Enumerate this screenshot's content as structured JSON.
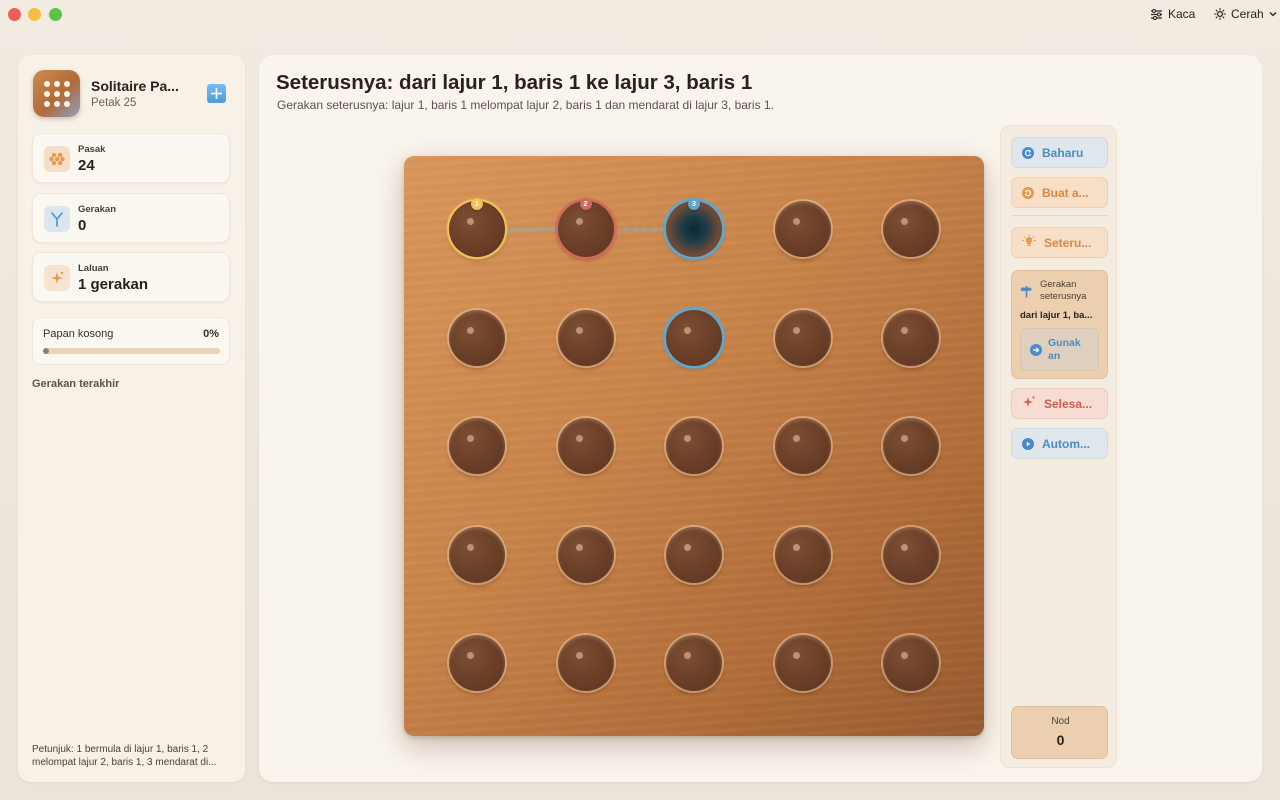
{
  "titlebar": {
    "glass_label": "Kaca",
    "theme_label": "Cerah",
    "glass_icon": "sliders-icon",
    "theme_icon": "sun-icon"
  },
  "sidebar": {
    "app_name": "Solitaire Pa...",
    "app_subtitle": "Petak 25",
    "stats": [
      {
        "label": "Pasak",
        "value": "24",
        "icon": "pegs-icon",
        "color": "#e39a4c"
      },
      {
        "label": "Gerakan",
        "value": "0",
        "icon": "branch-icon",
        "color": "#4b9be0"
      },
      {
        "label": "Laluan",
        "value": "1 gerakan",
        "icon": "sparkle-icon",
        "color": "#e39a4c"
      }
    ],
    "progress": {
      "label": "Papan kosong",
      "percent_text": "0%",
      "fraction": 0.0
    },
    "recent_title": "Gerakan terakhir",
    "hint": "Petunjuk: 1 bermula di lajur 1, baris 1, 2 melompat lajur 2, baris 1, 3 mendarat di..."
  },
  "main": {
    "title": "Seterusnya: dari lajur 1, baris 1 ke lajur 3, baris 1",
    "subtitle": "Gerakan seterusnya: lajur 1, baris 1 melompat lajur 2, baris 1 dan mendarat di lajur 3, baris 1."
  },
  "board": {
    "rows": 5,
    "cols": 5,
    "empty": [
      [
        0,
        2
      ]
    ],
    "highlight": [
      {
        "row": 0,
        "col": 0,
        "style": "gold",
        "badge": "1",
        "color": "#f1c25b"
      },
      {
        "row": 0,
        "col": 1,
        "style": "red",
        "badge": "2",
        "color": "#d06a5d"
      },
      {
        "row": 0,
        "col": 2,
        "style": "blue",
        "badge": "3",
        "color": "#5fa7cf"
      },
      {
        "row": 1,
        "col": 2,
        "style": "blue"
      }
    ]
  },
  "toolbar": {
    "new_label": "Baharu",
    "create_label": "Buat a...",
    "next_label": "Seteru...",
    "next_card": {
      "title": "Gerakan seterusnya",
      "move": "dari lajur 1, ba...",
      "use_label": "Gunak an"
    },
    "solve_label": "Selesa...",
    "auto_label": "Autom...",
    "node_label": "Nod",
    "node_value": "0"
  }
}
